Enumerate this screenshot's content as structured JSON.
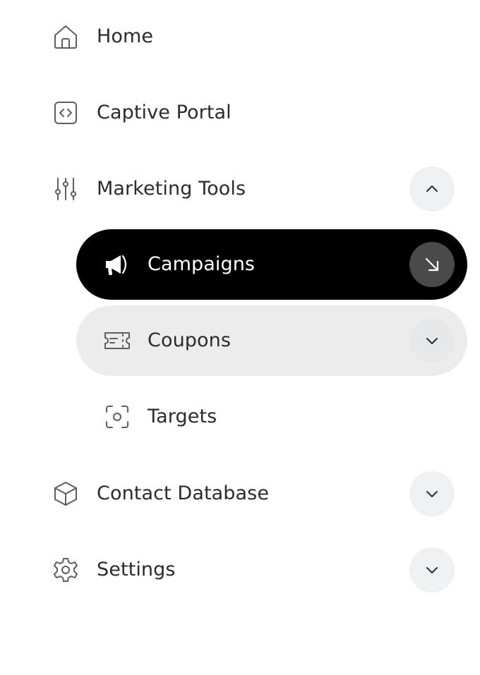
{
  "nav": {
    "home": {
      "label": "Home",
      "icon": "home-icon"
    },
    "captive_portal": {
      "label": "Captive Portal",
      "icon": "code-square-icon"
    },
    "marketing_tools": {
      "label": "Marketing Tools",
      "icon": "sliders-icon",
      "expanded": true,
      "children": {
        "campaigns": {
          "label": "Campaigns",
          "icon": "megaphone-icon",
          "active": true,
          "action_icon": "arrow-down-right-icon"
        },
        "coupons": {
          "label": "Coupons",
          "icon": "ticket-icon",
          "expanded": false
        },
        "targets": {
          "label": "Targets",
          "icon": "target-scan-icon"
        }
      }
    },
    "contact_database": {
      "label": "Contact Database",
      "icon": "cube-icon",
      "expanded": false
    },
    "settings": {
      "label": "Settings",
      "icon": "gear-icon",
      "expanded": false
    }
  },
  "colors": {
    "active_bg": "#000000",
    "active_text": "#ffffff",
    "hover_bg": "#ececec",
    "toggle_bg": "#eef0f1",
    "text": "#2b2b2b",
    "icon": "#5a5a5a"
  }
}
